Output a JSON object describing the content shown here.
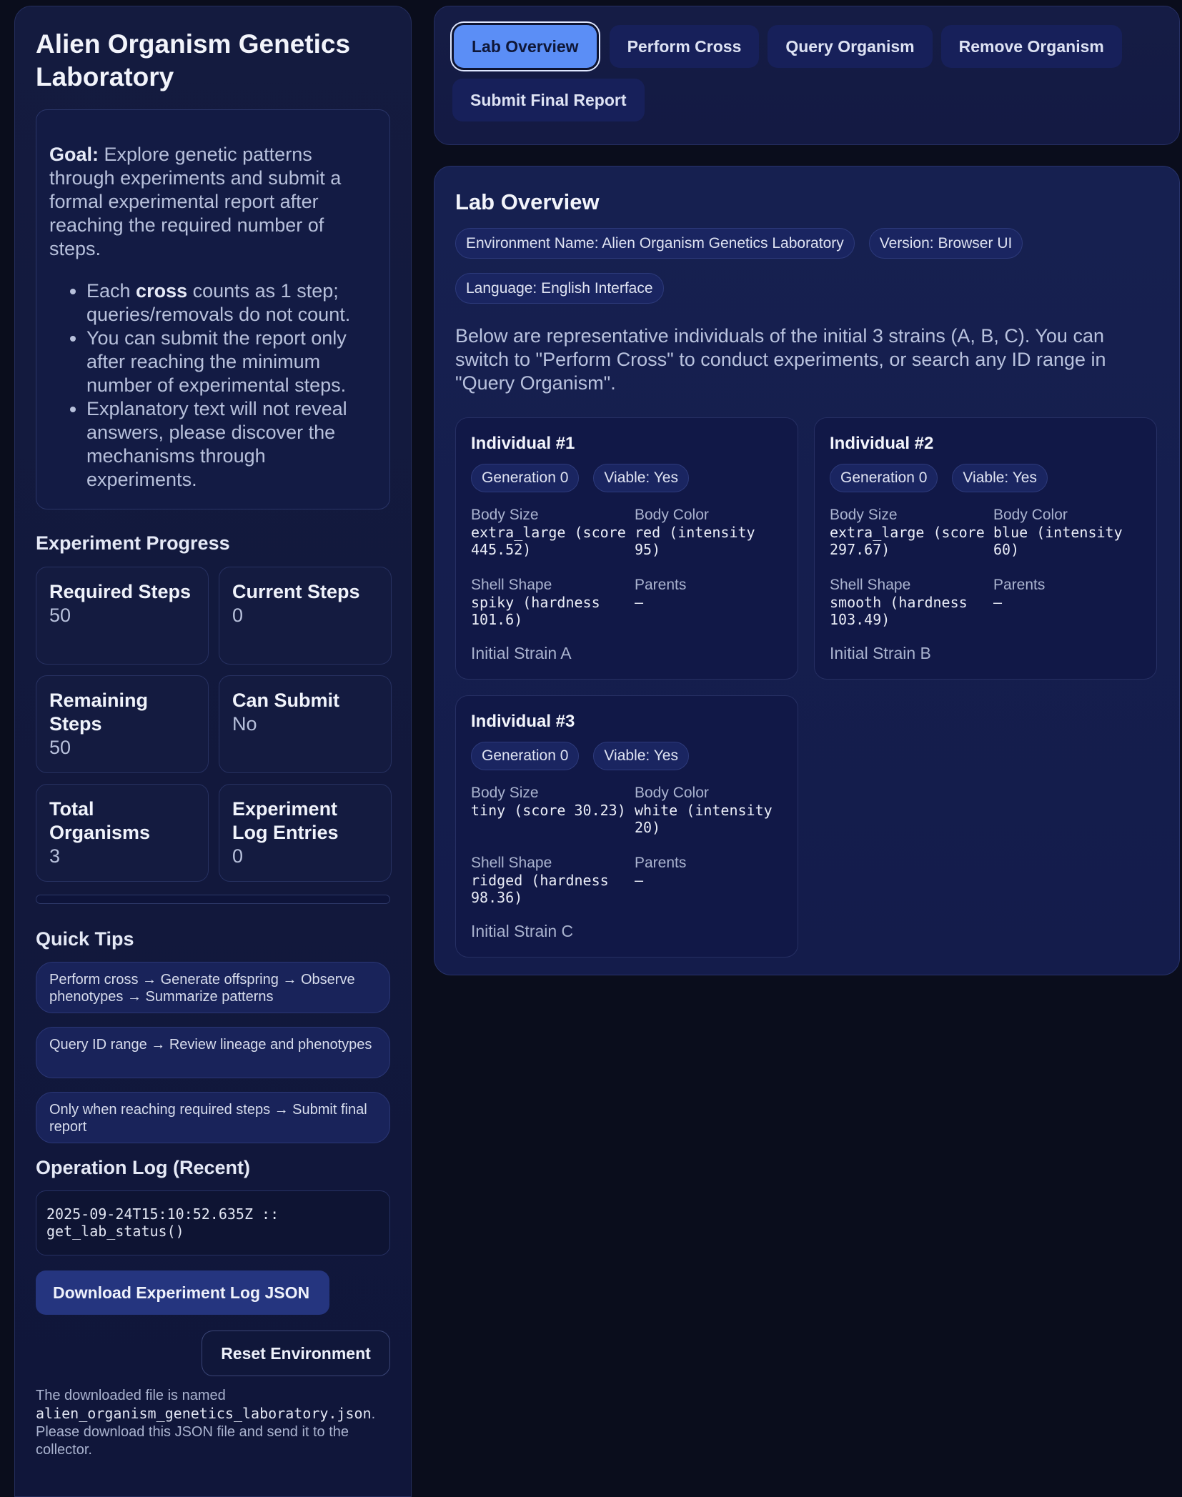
{
  "app": {
    "title": "Alien Organism Genetics Laboratory"
  },
  "goal": {
    "label": "Goal:",
    "text": "Explore genetic patterns through experiments and submit a formal experimental report after reaching the required number of steps.",
    "bullets": [
      {
        "pre": "Each ",
        "bold": "cross",
        "post": " counts as 1 step; queries/removals do not count."
      },
      {
        "pre": "You can submit the report only after reaching the minimum number of experimental steps.",
        "bold": "",
        "post": ""
      },
      {
        "pre": "Explanatory text will not reveal answers, please discover the mechanisms through experiments.",
        "bold": "",
        "post": ""
      }
    ]
  },
  "progress": {
    "title": "Experiment Progress",
    "stats": [
      {
        "label": "Required Steps",
        "value": "50"
      },
      {
        "label": "Current Steps",
        "value": "0"
      },
      {
        "label": "Remaining Steps",
        "value": "50"
      },
      {
        "label": "Can Submit",
        "value": "No"
      },
      {
        "label": "Total Organisms",
        "value": "3"
      },
      {
        "label": "Experiment Log Entries",
        "value": "0"
      }
    ],
    "bar_fraction": 0
  },
  "tips": {
    "title": "Quick Tips",
    "items": [
      "Perform cross → Generate offspring → Observe phenotypes → Summarize patterns",
      "Query ID range → Review lineage and phenotypes",
      "Only when reaching required steps → Submit final report"
    ]
  },
  "oplog": {
    "title": "Operation Log (Recent)",
    "entries": [
      "2025-09-24T15:10:52.635Z :: get_lab_status()"
    ]
  },
  "actions": {
    "download_label": "Download Experiment Log JSON",
    "reset_label": "Reset Environment"
  },
  "footnote": {
    "pre": "The downloaded file is named ",
    "filename": "alien_organism_genetics_laboratory.json",
    "post": ". Please download this JSON file and send it to the collector."
  },
  "tabs": [
    {
      "label": "Lab Overview",
      "active": true
    },
    {
      "label": "Perform Cross",
      "active": false
    },
    {
      "label": "Query Organism",
      "active": false
    },
    {
      "label": "Remove Organism",
      "active": false
    },
    {
      "label": "Submit Final Report",
      "active": false
    }
  ],
  "overview": {
    "title": "Lab Overview",
    "chips": [
      "Environment Name: Alien Organism Genetics Laboratory",
      "Version: Browser UI",
      "Language: English Interface"
    ],
    "intro": "Below are representative individuals of the initial 3 strains (A, B, C). You can switch to \"Perform Cross\" to conduct experiments, or search any ID range in \"Query Organism\"."
  },
  "individuals": [
    {
      "title": "Individual #1",
      "generation": "Generation 0",
      "viable": "Viable: Yes",
      "body_size_label": "Body Size",
      "body_size": "extra_large (score 445.52)",
      "body_color_label": "Body Color",
      "body_color": "red (intensity 95)",
      "shell_shape_label": "Shell Shape",
      "shell_shape": "spiky (hardness 101.6)",
      "parents_label": "Parents",
      "parents": "—",
      "note": "Initial Strain A"
    },
    {
      "title": "Individual #2",
      "generation": "Generation 0",
      "viable": "Viable: Yes",
      "body_size_label": "Body Size",
      "body_size": "extra_large (score 297.67)",
      "body_color_label": "Body Color",
      "body_color": "blue (intensity 60)",
      "shell_shape_label": "Shell Shape",
      "shell_shape": "smooth (hardness 103.49)",
      "parents_label": "Parents",
      "parents": "—",
      "note": "Initial Strain B"
    },
    {
      "title": "Individual #3",
      "generation": "Generation 0",
      "viable": "Viable: Yes",
      "body_size_label": "Body Size",
      "body_size": "tiny (score 30.23)",
      "body_color_label": "Body Color",
      "body_color": "white (intensity 20)",
      "shell_shape_label": "Shell Shape",
      "shell_shape": "ridged (hardness 98.36)",
      "parents_label": "Parents",
      "parents": "—",
      "note": "Initial Strain C"
    }
  ],
  "colors": {
    "accent": "#5b8ef6",
    "background": "#0a0d1c",
    "panel": "#151c45"
  }
}
